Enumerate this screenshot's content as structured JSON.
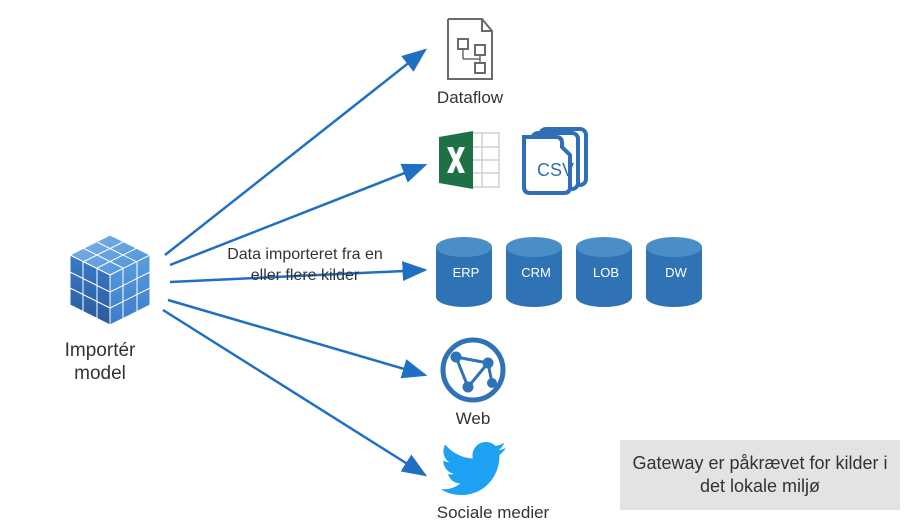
{
  "source": {
    "label": "Importér model"
  },
  "arrow_caption": "Data importeret fra en eller flere kilder",
  "targets": {
    "dataflow": {
      "label": "Dataflow"
    },
    "web": {
      "label": "Web"
    },
    "social": {
      "label": "Sociale medier"
    },
    "csv": {
      "label": "CSV"
    },
    "cylinders": [
      {
        "label": "ERP"
      },
      {
        "label": "CRM"
      },
      {
        "label": "LOB"
      },
      {
        "label": "DW"
      }
    ]
  },
  "note": "Gateway er påkrævet for kilder i det lokale miljø",
  "colors": {
    "arrow": "#1f6fc3",
    "cylinder": "#2f73b5",
    "excel": "#1e7145",
    "twitter": "#1da1f2",
    "csv": "#2f6fb7"
  }
}
